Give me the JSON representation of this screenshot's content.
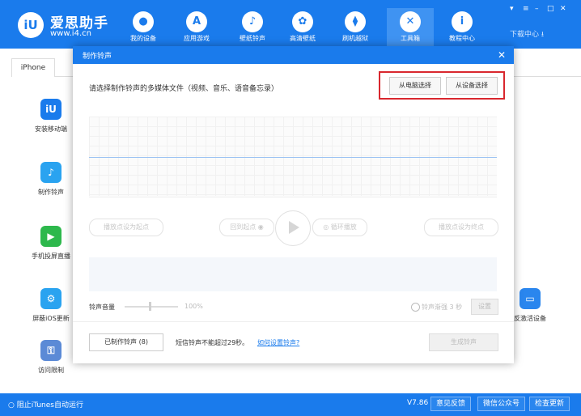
{
  "app": {
    "name": "爱思助手",
    "url": "www.i4.cn",
    "logo": "iU"
  },
  "nav": [
    {
      "label": "我的设备",
      "icon": "apple-icon",
      "glyph": ""
    },
    {
      "label": "应用游戏",
      "icon": "app-store-icon",
      "glyph": "A"
    },
    {
      "label": "壁纸铃声",
      "icon": "bell-icon",
      "glyph": "♪"
    },
    {
      "label": "高清壁纸",
      "icon": "flower-icon",
      "glyph": "✿"
    },
    {
      "label": "刷机越狱",
      "icon": "box-icon",
      "glyph": "⧫"
    },
    {
      "label": "工具箱",
      "icon": "tools-icon",
      "glyph": "✕"
    },
    {
      "label": "教程中心",
      "icon": "info-icon",
      "glyph": "i"
    }
  ],
  "window": {
    "download_center": "下载中心 ⭳",
    "controls": [
      "▾",
      "≡",
      "–",
      "□",
      "✕"
    ]
  },
  "device_tab": "iPhone",
  "left_tools": [
    {
      "label": "安装移动端",
      "icon": "i4-app-icon",
      "color": "#1a7bec",
      "glyph": "iU"
    },
    {
      "label": "制作铃声",
      "icon": "bell-plus-icon",
      "color": "#2aa3f0",
      "glyph": "♪"
    },
    {
      "label": "手机投屏直播",
      "icon": "screen-mirror-icon",
      "color": "#2db84c",
      "glyph": "▶"
    },
    {
      "label": "屏蔽iOS更新",
      "icon": "gear-block-icon",
      "color": "#2aa3f0",
      "glyph": "⚙"
    },
    {
      "label": "访问限制",
      "icon": "key-icon",
      "color": "#5b8ad6",
      "glyph": "⚿"
    }
  ],
  "right_tool": {
    "label": "反激活设备",
    "icon": "tablet-icon",
    "color": "#2a86ee",
    "glyph": "▭"
  },
  "modal": {
    "title": "制作铃声",
    "prompt": "请选择制作铃声的多媒体文件（视频、音乐、语音备忘录）",
    "from_pc": "从电脑选择",
    "from_device": "从设备选择",
    "set_start": "播放点设为起点",
    "back_to_start": "回到起点",
    "loop_play": "循环播放",
    "set_end": "播放点设为终点",
    "volume_label": "铃声音量",
    "volume_value": "100%",
    "volume_fraction": 0.5,
    "fade_label": "铃声渐强 3 秒",
    "settings": "设置",
    "made_ringtones": "已制作铃声 (8)",
    "note": "短信铃声不能超过29秒。",
    "how_link": "如何设置铃声?",
    "generate": "生成铃声"
  },
  "bottom": {
    "itunes": "阻止iTunes自动运行",
    "version": "V7.86",
    "feedback": "意见反馈",
    "wechat": "微信公众号",
    "update": "检查更新"
  },
  "colors": {
    "primary": "#1a7bec",
    "highlight": "#d9272e"
  }
}
